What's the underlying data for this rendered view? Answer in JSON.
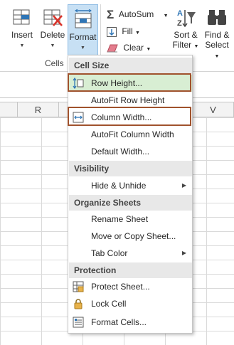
{
  "ribbon": {
    "insert_label": "Insert",
    "delete_label": "Delete",
    "format_label": "Format",
    "cells_group_label": "Cells",
    "autosum_label": "AutoSum",
    "fill_label": "Fill",
    "clear_label": "Clear",
    "sort_label_1": "Sort &",
    "sort_label_2": "Filter",
    "find_label_1": "Find &",
    "find_label_2": "Select"
  },
  "sheet": {
    "columns": [
      "R",
      "V"
    ]
  },
  "menu": {
    "section_cell_size": "Cell Size",
    "row_height": "Row Height...",
    "autofit_row_height": "AutoFit Row Height",
    "column_width": "Column Width...",
    "autofit_column_width": "AutoFit Column Width",
    "default_width": "Default Width...",
    "section_visibility": "Visibility",
    "hide_unhide": "Hide & Unhide",
    "section_organize": "Organize Sheets",
    "rename_sheet": "Rename Sheet",
    "move_copy_sheet": "Move or Copy Sheet...",
    "tab_color": "Tab Color",
    "section_protection": "Protection",
    "protect_sheet": "Protect Sheet...",
    "lock_cell": "Lock Cell",
    "format_cells": "Format Cells..."
  },
  "colors": {
    "highlight": "#d8eed3",
    "annotation": "#a0522d",
    "active_button": "#c7e0f4"
  }
}
